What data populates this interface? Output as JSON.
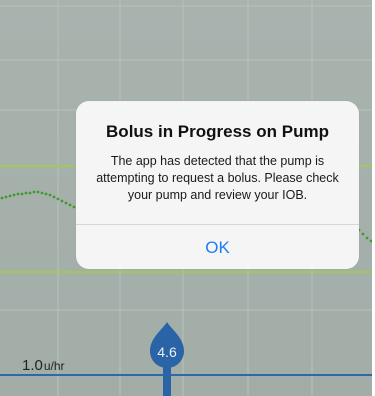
{
  "alert": {
    "title": "Bolus in Progress on Pump",
    "message": "The app has detected that the pump is attempting to request a bolus. Please check your pump and review your IOB.",
    "ok_label": "OK"
  },
  "chart": {
    "basal_rate_value": "1.0",
    "basal_rate_unit": "u/hr",
    "bolus_marker_value": "4.6"
  },
  "colors": {
    "chart_background": "#a6b0ab",
    "grid_line": "#b9c2bd",
    "target_range_line": "#9fcf3e",
    "glucose_dots": "#3f9a2f",
    "basal_line": "#2d68a8",
    "bolus_marker": "#2a64a6",
    "alert_background": "#f8f8f8",
    "alert_button_text": "#1f7bf6"
  },
  "icons": {
    "bolus_marker": "teardrop-bolus-icon"
  }
}
